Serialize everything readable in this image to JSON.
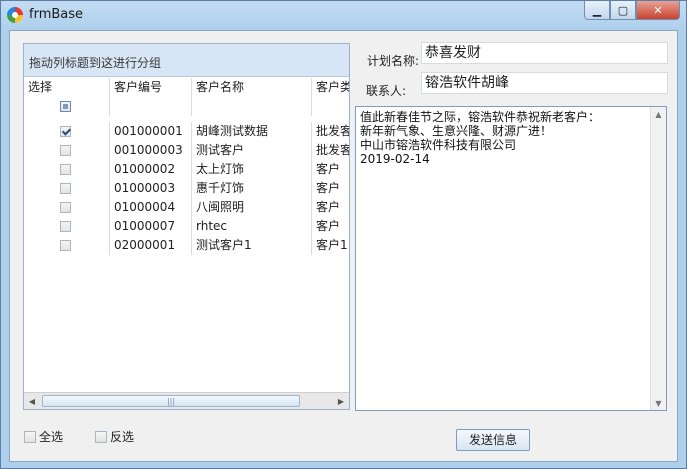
{
  "window": {
    "title": "frmBase",
    "controls": {
      "minimize": "▁",
      "maximize": "▢",
      "close": "✕"
    }
  },
  "grid": {
    "group_panel_text": "拖动列标题到这进行分组",
    "columns": [
      "选择",
      "客户编号",
      "客户名称",
      "客户类"
    ],
    "rows": [
      {
        "checked": true,
        "code": "001000001",
        "name": "胡峰测试数据",
        "type": "批发客"
      },
      {
        "checked": false,
        "code": "001000003",
        "name": "测试客户",
        "type": "批发客"
      },
      {
        "checked": false,
        "code": "01000002",
        "name": "太上灯饰",
        "type": "客户"
      },
      {
        "checked": false,
        "code": "01000003",
        "name": "惠千灯饰",
        "type": "客户"
      },
      {
        "checked": false,
        "code": "01000004",
        "name": "八闽照明",
        "type": "客户"
      },
      {
        "checked": false,
        "code": "01000007",
        "name": "rhtec",
        "type": "客户"
      },
      {
        "checked": false,
        "code": "02000001",
        "name": "测试客户1",
        "type": "客户1"
      }
    ],
    "scroll_grip": "|||"
  },
  "actions": {
    "select_all": "全选",
    "invert": "反选",
    "send": "发送信息"
  },
  "form": {
    "plan_label": "计划名称:",
    "plan_value": "恭喜发财",
    "contact_label": "联系人:",
    "contact_value": "镕浩软件胡峰",
    "message": "值此新春佳节之际，镕浩软件恭祝新老客户：\n新年新气象、生意兴隆、财源广进！\n中山市镕浩软件科技有限公司\n2019-02-14"
  },
  "colors": {
    "title_bar": "#aed0ec",
    "selected_row": "#dcebfa",
    "close_button": "#c7432f"
  }
}
